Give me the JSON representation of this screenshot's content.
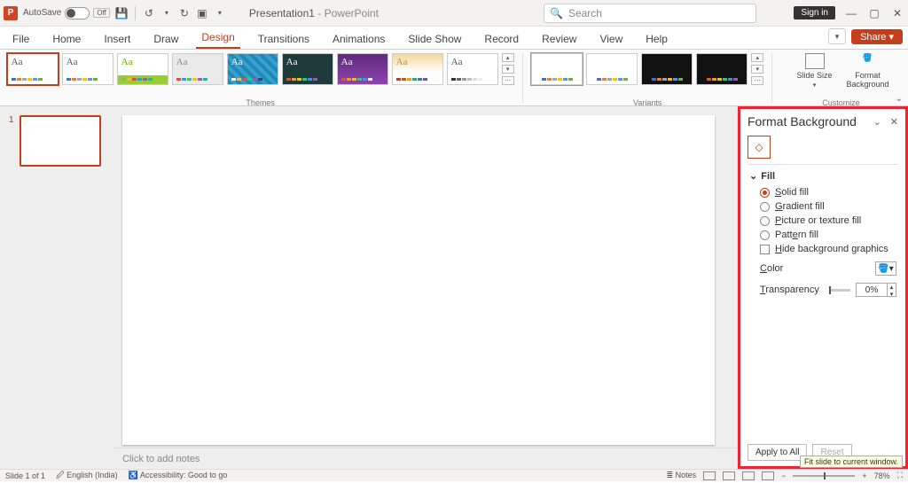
{
  "title": {
    "autosave": "AutoSave",
    "autosave_state": "Off",
    "doc": "Presentation1",
    "appsuffix": " - PowerPoint",
    "search_placeholder": "Search",
    "signin": "Sign in",
    "share": "Share"
  },
  "tabs": [
    "File",
    "Home",
    "Insert",
    "Draw",
    "Design",
    "Transitions",
    "Animations",
    "Slide Show",
    "Record",
    "Review",
    "View",
    "Help"
  ],
  "active_tab": "Design",
  "ribbon": {
    "themes_label": "Themes",
    "variants_label": "Variants",
    "customize_label": "Customize",
    "slide_size": "Slide Size",
    "format_bg": "Format Background"
  },
  "pane": {
    "title": "Format Background",
    "section_fill": "Fill",
    "opt_solid": "Solid fill",
    "opt_gradient": "Gradient fill",
    "opt_picture": "Picture or texture fill",
    "opt_pattern": "Pattern fill",
    "chk_hide": "Hide background graphics",
    "lbl_color": "Color",
    "lbl_transparency": "Transparency",
    "transparency_value": "0%",
    "apply_all": "Apply to All",
    "reset": "Reset"
  },
  "notes_placeholder": "Click to add notes",
  "status": {
    "slide": "Slide 1 of 1",
    "lang": "English (India)",
    "access": "Accessibility: Good to go",
    "notes_btn": "Notes",
    "zoom": "78%"
  },
  "tooltip": "Fit slide to current window.",
  "slide_number": "1"
}
